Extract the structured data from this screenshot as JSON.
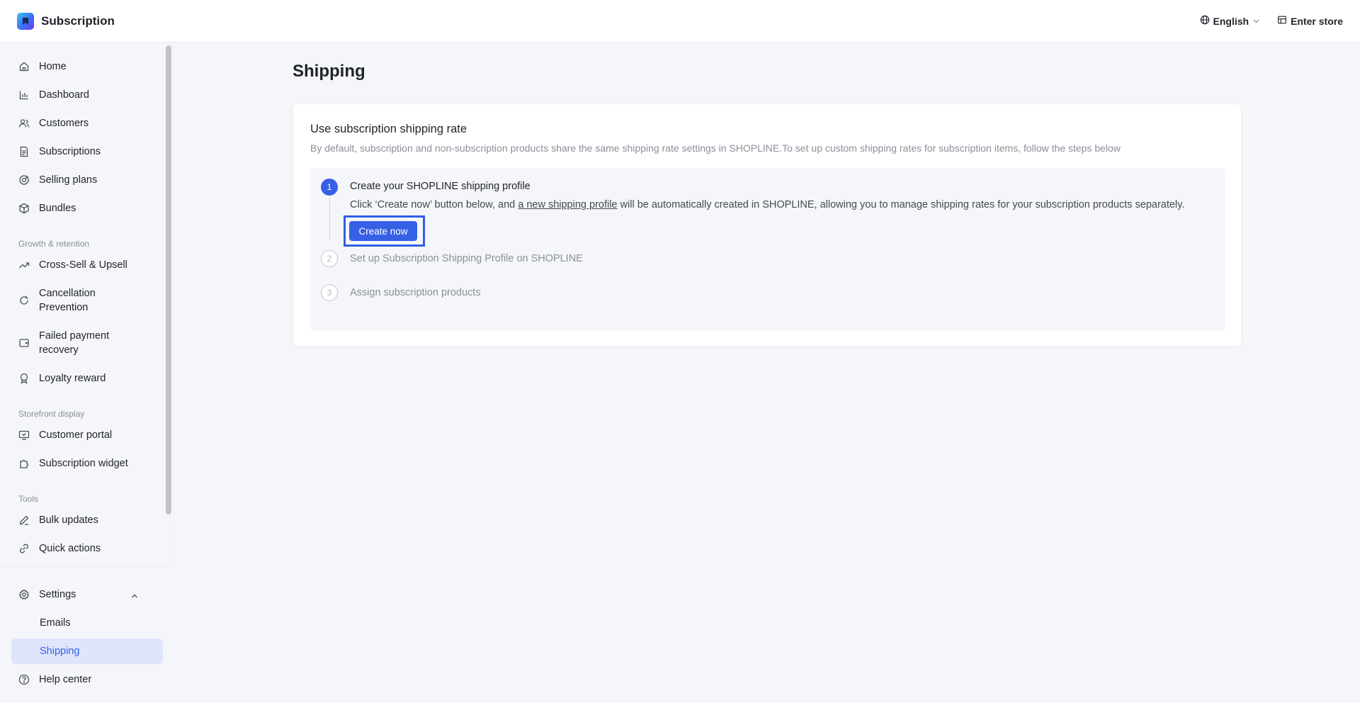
{
  "header": {
    "app_title": "Subscription",
    "language": "English",
    "enter_store": "Enter store"
  },
  "sidebar": {
    "items": [
      {
        "label": "Home",
        "icon": "home-icon"
      },
      {
        "label": "Dashboard",
        "icon": "bar-chart-icon"
      },
      {
        "label": "Customers",
        "icon": "users-icon"
      },
      {
        "label": "Subscriptions",
        "icon": "document-icon"
      },
      {
        "label": "Selling plans",
        "icon": "selling-plans-icon"
      },
      {
        "label": "Bundles",
        "icon": "box-icon"
      }
    ],
    "growth_label": "Growth & retention",
    "growth_items": [
      {
        "label": "Cross-Sell & Upsell",
        "icon": "trend-up-icon"
      },
      {
        "label": "Cancellation Prevention",
        "icon": "refresh-icon"
      },
      {
        "label": "Failed payment recovery",
        "icon": "wallet-icon"
      },
      {
        "label": "Loyalty reward",
        "icon": "award-icon"
      }
    ],
    "storefront_label": "Storefront display",
    "storefront_items": [
      {
        "label": "Customer portal",
        "icon": "monitor-icon"
      },
      {
        "label": "Subscription widget",
        "icon": "puzzle-icon"
      }
    ],
    "tools_label": "Tools",
    "tools_items": [
      {
        "label": "Bulk updates",
        "icon": "pencil-icon"
      },
      {
        "label": "Quick actions",
        "icon": "link-icon"
      }
    ],
    "settings": {
      "label": "Settings",
      "children": [
        "Emails",
        "Shipping"
      ],
      "active": "Shipping"
    },
    "help": "Help center"
  },
  "main": {
    "page_title": "Shipping",
    "card": {
      "title": "Use subscription shipping rate",
      "description": "By default, subscription and non-subscription products share the same shipping rate settings in SHOPLINE.To set up custom shipping rates for subscription items, follow the steps below",
      "steps": [
        {
          "number": "1",
          "title": "Create your SHOPLINE shipping profile",
          "desc_before": "Click ‘Create now’ button below, and ",
          "desc_link": "a new shipping profile",
          "desc_after": " will be automatically created in SHOPLINE, allowing you to manage shipping rates for your subscription products separately.",
          "button": "Create now"
        },
        {
          "number": "2",
          "title": "Set up Subscription Shipping Profile on SHOPLINE"
        },
        {
          "number": "3",
          "title": "Assign subscription products"
        }
      ]
    }
  },
  "colors": {
    "accent": "#3660e6",
    "active_nav_bg": "#dfe6fb",
    "page_bg": "#f5f6fa"
  }
}
